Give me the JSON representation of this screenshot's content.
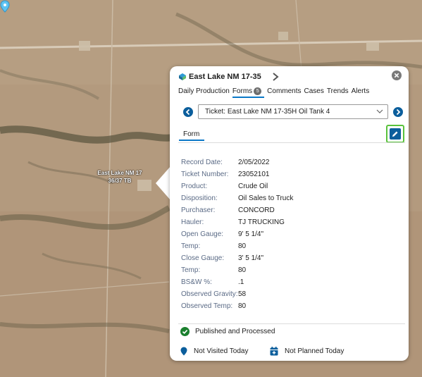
{
  "map": {
    "marker_label": "East Lake NM 17 36/37 TB"
  },
  "popup": {
    "title": "East Lake NM 17-35",
    "tabs": [
      {
        "label": "Daily Production"
      },
      {
        "label": "Forms",
        "badge": "5",
        "active": true
      },
      {
        "label": "Comments"
      },
      {
        "label": "Cases"
      },
      {
        "label": "Trends"
      },
      {
        "label": "Alerts"
      }
    ],
    "ticket_select": "Ticket: East Lake NM 17-35H Oil Tank 4",
    "form_tab": "Form",
    "fields": [
      {
        "label": "Record Date:",
        "value": "2/05/2022"
      },
      {
        "label": "Ticket Number:",
        "value": "23052101"
      },
      {
        "label": "Product:",
        "value": "Crude Oil"
      },
      {
        "label": "Disposition:",
        "value": "Oil Sales to Truck"
      },
      {
        "label": "Purchaser:",
        "value": "CONCORD"
      },
      {
        "label": "Hauler:",
        "value": "TJ TRUCKING"
      },
      {
        "label": "Open Gauge:",
        "value": "9' 5 1/4\""
      },
      {
        "label": "Temp:",
        "value": "80"
      },
      {
        "label": "Close Gauge:",
        "value": "3' 5 1/4\""
      },
      {
        "label": "Temp:",
        "value": "80"
      },
      {
        "label": "BS&W %:",
        "value": ".1"
      },
      {
        "label": "Observed Gravity:",
        "value": "58"
      },
      {
        "label": "Observed Temp:",
        "value": "80"
      }
    ],
    "status": "Published and Processed",
    "visited": "Not Visited Today",
    "planned": "Not Planned Today"
  },
  "colors": {
    "accent": "#0b78c7",
    "nav_blue": "#0b5e9c",
    "edit_border": "#59c23c",
    "status_green": "#1a7f2e"
  },
  "icons": [
    "well-icon",
    "chevron-right-icon",
    "close-icon",
    "arrow-left-icon",
    "arrow-right-icon",
    "dropdown-chevron-icon",
    "edit-pencil-icon",
    "check-circle-icon",
    "map-pin-icon",
    "calendar-icon"
  ]
}
